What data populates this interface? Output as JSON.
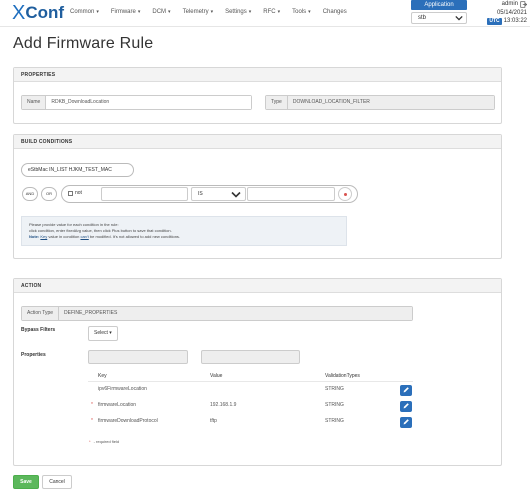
{
  "app": {
    "logo_mark": "X",
    "logo_text": "Conf"
  },
  "nav": {
    "items": [
      {
        "label": "Common",
        "dropdown": true
      },
      {
        "label": "Firmware",
        "dropdown": true
      },
      {
        "label": "DCM",
        "dropdown": true
      },
      {
        "label": "Telemetry",
        "dropdown": true
      },
      {
        "label": "Settings",
        "dropdown": true
      },
      {
        "label": "RFC",
        "dropdown": true
      },
      {
        "label": "Tools",
        "dropdown": true
      },
      {
        "label": "Changes",
        "dropdown": false
      }
    ]
  },
  "application": {
    "title": "Application",
    "selected": "stb"
  },
  "user": {
    "name": "admin",
    "date": "05/14/2021",
    "utc_badge": "UTC",
    "time": "13:03:22"
  },
  "page": {
    "title": "Add Firmware Rule"
  },
  "properties": {
    "heading": "PROPERTIES",
    "name_label": "Name",
    "name_value": "RDKB_DownloadLocation",
    "type_label": "Type",
    "type_value": "DOWNLOAD_LOCATION_FILTER"
  },
  "conditions": {
    "heading": "BUILD CONDITIONS",
    "existing_condition": "eStbMac  IN_LIST  HJKM_TEST_MAC",
    "and_label": "AND",
    "or_label": "OR",
    "not_label": "not",
    "operation_value": "IS",
    "help_line1": "Please provide value for each condition in the rule:",
    "help_line2": "click condition, enter fixedArg value, then click Plus button to save that condition.",
    "help_note_label": "Note:",
    "help_note_text_1": "Key",
    "help_note_text_2": "value in condition",
    "help_note_text_3": "can't",
    "help_note_text_4": "be modified. It's not allowed to add new conditions."
  },
  "action": {
    "heading": "ACTION",
    "action_type_label": "Action Type",
    "action_type_value": "DEFINE_PROPERTIES",
    "bypass_label": "Bypass Filters",
    "select_label": "Select",
    "properties_label": "Properties",
    "columns": [
      "Key",
      "Value",
      "ValidationTypes"
    ],
    "rows": [
      {
        "required": false,
        "key": "ipv6FirmwareLocation",
        "value": "",
        "validation": "STRING"
      },
      {
        "required": true,
        "key": "firmwareLocation",
        "value": "192.168.1.9",
        "validation": "STRING"
      },
      {
        "required": true,
        "key": "firmwareDownloadProtocol",
        "value": "tftp",
        "validation": "STRING"
      }
    ],
    "required_mark": "*",
    "required_note": "- required field"
  },
  "buttons": {
    "save": "Save",
    "cancel": "Cancel"
  },
  "colors": {
    "primary": "#2b6fba",
    "success": "#5cb85c",
    "danger": "#d9534f"
  }
}
